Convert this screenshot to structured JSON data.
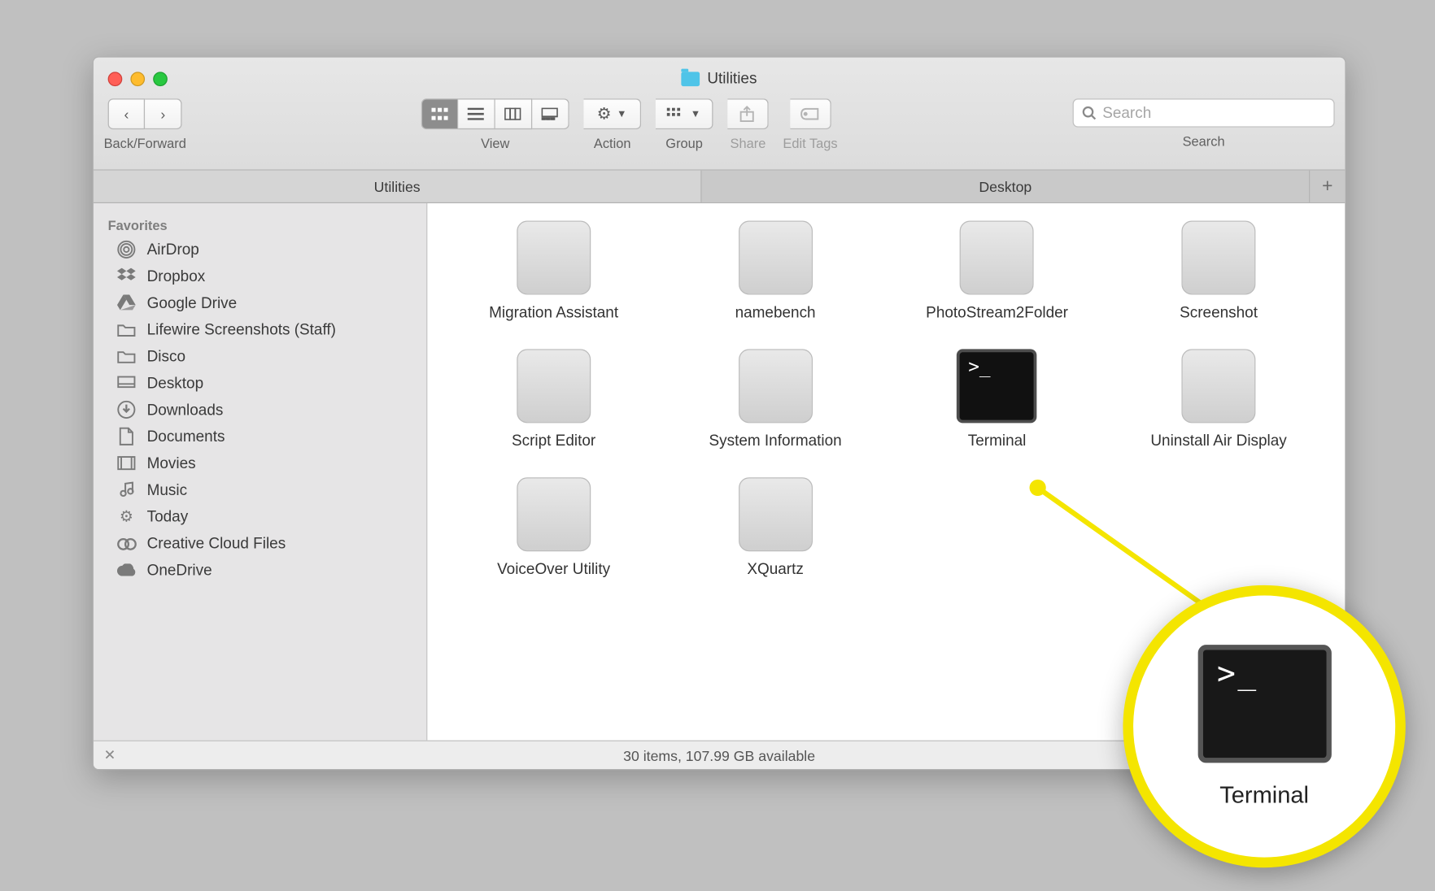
{
  "window": {
    "title": "Utilities",
    "traffic": {
      "close": "close",
      "minimize": "minimize",
      "zoom": "zoom"
    }
  },
  "toolbar": {
    "back_forward_label": "Back/Forward",
    "view_label": "View",
    "action_label": "Action",
    "group_label": "Group",
    "share_label": "Share",
    "edit_tags_label": "Edit Tags",
    "search_label": "Search",
    "search_placeholder": "Search"
  },
  "tabs": [
    {
      "label": "Utilities",
      "active": true
    },
    {
      "label": "Desktop",
      "active": false
    }
  ],
  "sidebar": {
    "header": "Favorites",
    "items": [
      {
        "label": "AirDrop",
        "icon": "airdrop"
      },
      {
        "label": "Dropbox",
        "icon": "dropbox"
      },
      {
        "label": "Google Drive",
        "icon": "gdrive"
      },
      {
        "label": "Lifewire Screenshots (Staff)",
        "icon": "folder"
      },
      {
        "label": "Disco",
        "icon": "folder"
      },
      {
        "label": "Desktop",
        "icon": "desktop"
      },
      {
        "label": "Downloads",
        "icon": "downloads"
      },
      {
        "label": "Documents",
        "icon": "documents"
      },
      {
        "label": "Movies",
        "icon": "movies"
      },
      {
        "label": "Music",
        "icon": "music"
      },
      {
        "label": "Today",
        "icon": "gear"
      },
      {
        "label": "Creative Cloud Files",
        "icon": "cc"
      },
      {
        "label": "OneDrive",
        "icon": "cloud"
      }
    ]
  },
  "apps": [
    {
      "name": "Migration Assistant"
    },
    {
      "name": "namebench"
    },
    {
      "name": "PhotoStream2Folder"
    },
    {
      "name": "Screenshot"
    },
    {
      "name": "Script Editor"
    },
    {
      "name": "System Information"
    },
    {
      "name": "Terminal",
      "highlight": true
    },
    {
      "name": "Uninstall Air Display"
    },
    {
      "name": "VoiceOver Utility"
    },
    {
      "name": "XQuartz"
    }
  ],
  "status": {
    "text": "30 items, 107.99 GB available"
  },
  "callout": {
    "label": "Terminal"
  }
}
